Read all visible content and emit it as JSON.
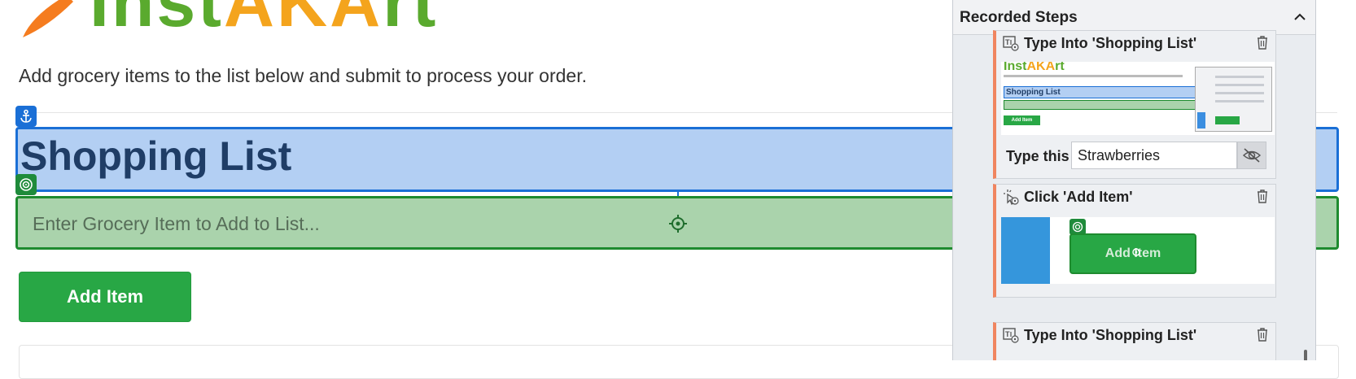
{
  "logo": {
    "wordmark_start": "Inst",
    "wordmark_accent": "AKA",
    "wordmark_end": "rt"
  },
  "page": {
    "intro": "Add grocery items to the list below and submit to process your order.",
    "heading": "Shopping List",
    "input_placeholder": "Enter Grocery Item to Add to List...",
    "add_button": "Add Item"
  },
  "panel": {
    "title": "Recorded Steps",
    "steps": [
      {
        "title": "Type Into 'Shopping List'",
        "type_label": "Type this",
        "type_value": "Strawberries",
        "thumb": {
          "logo_start": "Inst",
          "logo_accent": "AKA",
          "logo_end": "rt",
          "heading": "Shopping List",
          "button": "Add Item"
        }
      },
      {
        "title": "Click 'Add Item'",
        "thumb": {
          "button": "Add Item"
        }
      },
      {
        "title": "Type Into 'Shopping List'"
      }
    ]
  },
  "colors": {
    "brand_green": "#5aaa2e",
    "brand_orange": "#f4a41d",
    "anchor_blue": "#1a6fd6",
    "target_green": "#1f8b3b",
    "button_green": "#28a745",
    "step_accent": "#f08560"
  }
}
